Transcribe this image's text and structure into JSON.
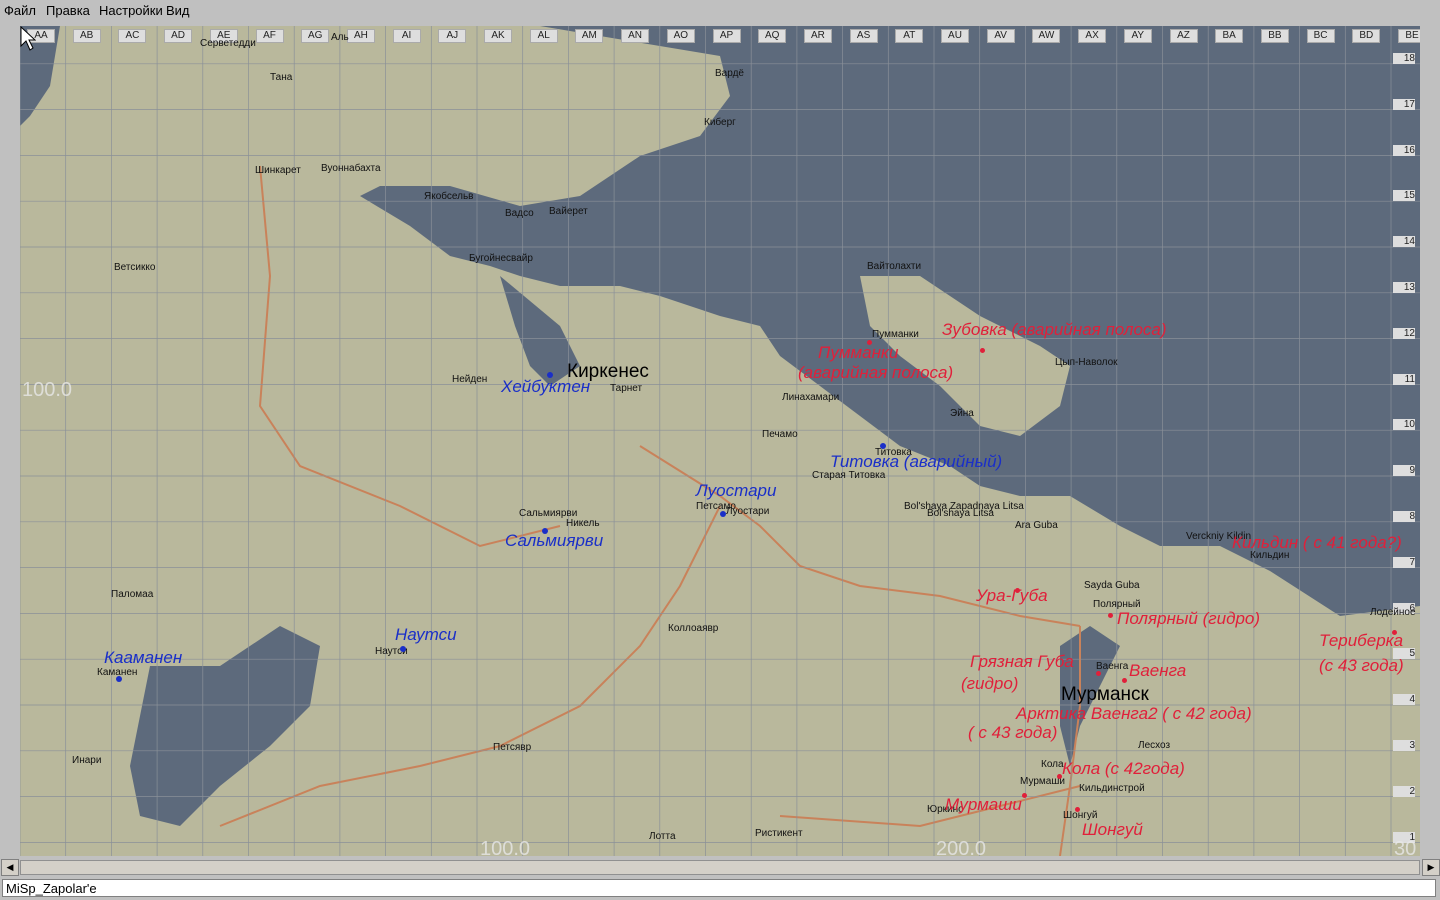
{
  "menu": [
    "Файл",
    "Правка",
    "Настройки",
    "Вид"
  ],
  "status": "MiSp_Zapolar'e",
  "map": {
    "columns": [
      "AA",
      "AB",
      "AC",
      "AD",
      "AE",
      "AF",
      "AG",
      "AH",
      "AI",
      "AJ",
      "AK",
      "AL",
      "AM",
      "AN",
      "AO",
      "AP",
      "AQ",
      "AR",
      "AS",
      "AT",
      "AU",
      "AV",
      "AW",
      "AX",
      "AY",
      "AZ",
      "BA",
      "BB",
      "BC",
      "BD",
      "BE"
    ],
    "rows": [
      "18",
      "17",
      "16",
      "15",
      "14",
      "13",
      "12",
      "11",
      "10",
      "9",
      "8",
      "7",
      "6",
      "5",
      "4",
      "3",
      "2",
      "1"
    ],
    "coords": [
      "100.0",
      "100.0",
      "200.0",
      "30"
    ],
    "places": [
      "Серветедди",
      "Тана",
      "Вардё",
      "Киберг",
      "Шинкарет",
      "Вуоннабахта",
      "Якобсельв",
      "Вадсо",
      "Вайерет",
      "Ветсикко",
      "Бугойнесвайр",
      "Вайтолахти",
      "Пумманки",
      "Цып-Наволок",
      "Нейден",
      "Тарнет",
      "Линахамари",
      "Печамо",
      "Эйна",
      "Титовка",
      "Старая Титовка",
      "Bol'shaya Zapadnaya Litsa",
      "Bol'shaya Litsa",
      "Ara Guba",
      "Verckniy Kildin",
      "Кильдин",
      "Сальмиярви",
      "Никель",
      "Петсамо",
      "Луостари",
      "Sayda Guba",
      "Полярный",
      "Лодейное",
      "Паломаа",
      "Коллоаявр",
      "Ваенга",
      "Каманен",
      "Наутси",
      "Инари",
      "Петсявр",
      "Лесхоз",
      "Мурмаши",
      "Кильдинстрой",
      "Кола",
      "Юркино",
      "Шонгуй",
      "Лотта",
      "Ристикент",
      "Аль"
    ],
    "cities": [
      "Киркенес",
      "Мурманск"
    ],
    "airfields_blue": [
      "Хейбуктен",
      "Титовка (аварийный)",
      "Луостари",
      "Сальмиярви",
      "Наутси",
      "Кааманен"
    ],
    "airfields_red": [
      "Зубовка (аварийная полоса)",
      "Пумманки",
      "(аварийная полоса)",
      "Кильдин ( с 41 года?)",
      "Ура-Губа",
      "Полярный (гидро)",
      "Териберка",
      "(с 43 года)",
      "Грязная Губа",
      "(гидро)",
      "Ваенга",
      "Арктика  Ваенга2  ( с 42 года)",
      "( с 43 года)",
      "Кола (с 42года)",
      "Мурмаши",
      "Шонгуй"
    ]
  },
  "colors": {
    "land": "#b9b89c",
    "water": "#5d6a7c",
    "river": "#c9825a",
    "grid": "#8a9098"
  }
}
